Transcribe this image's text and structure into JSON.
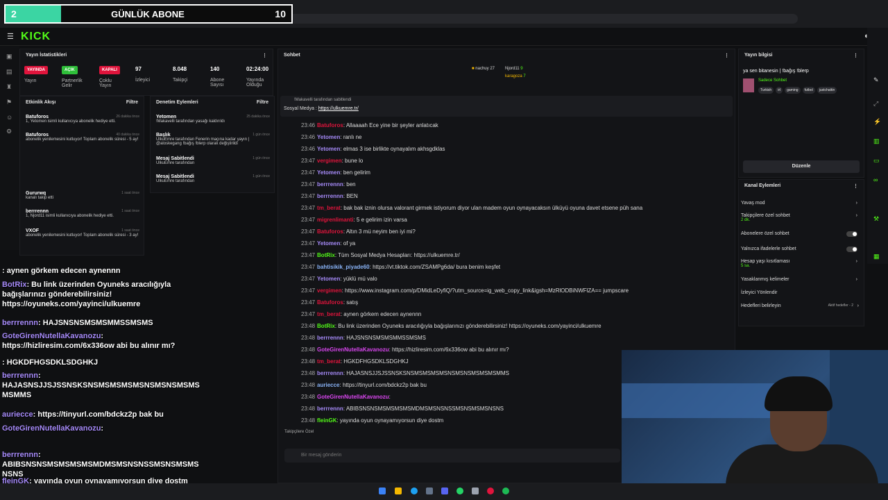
{
  "browser": {
    "url": "dashboard.kick.com/stream"
  },
  "sub_goal": {
    "current": "2",
    "label": "GÜNLÜK ABONE",
    "target": "10"
  },
  "stats": {
    "title": "Yayın İstatistikleri",
    "items": [
      {
        "badge": "YAYINDA",
        "label": "Yayın",
        "color": "#e0143c"
      },
      {
        "badge": "AÇIK",
        "label": "Partnerlik Gelir",
        "color": "#2fbf3a"
      },
      {
        "badge": "KAPALI",
        "label": "Çoklu Yayın",
        "color": "#e0143c"
      },
      {
        "value": "97",
        "label": "İzleyici"
      },
      {
        "value": "8.048",
        "label": "Takipçi"
      },
      {
        "value": "140",
        "label": "Abone Sayısı"
      },
      {
        "value": "02:24:00",
        "label": "Yayında Olduğu"
      }
    ]
  },
  "activity": {
    "title": "Etkinlik Akışı",
    "filter": "Filtre",
    "items": [
      {
        "user": "Batuforos",
        "text": "1, Yetomen isimli kullanıcıya abonelik hediye etti.",
        "time": "26 dakika önce"
      },
      {
        "user": "Batuforos",
        "text": "abonelik yenilemesini kutluyor! Toplam abonelik süresi - 5 ay!",
        "time": "40 dakika önce"
      },
      {
        "user": "Gururwq",
        "text": "kanalı takip etti",
        "time": "1 saat önce"
      },
      {
        "user": "berrrennn",
        "text": "1, Njord11 isimli kullanıcıya abonelik hediye etti.",
        "time": "1 saat önce"
      },
      {
        "user": "VXOF",
        "text": "abonelik yenilemesini kutluyor! Toplam abonelik süresi - 3 ay!",
        "time": "1 saat önce"
      }
    ]
  },
  "modacts": {
    "title": "Denetim Eylemleri",
    "filter": "Filtre",
    "items": [
      {
        "user": "Yetomen",
        "text": "!Makavelli tarafından yasağı kaldırıldı",
        "time": "25 dakika önce"
      },
      {
        "user": "Başlık",
        "text": "UlkuEmre tarafından Fenerin maçına kadar yayın | @aloskegang !bağış !blerp olarak değiştirildi",
        "time": "1 gün önce"
      },
      {
        "user": "Mesaj Sabitlendi",
        "text": "UlkuEmre tarafından",
        "time": "1 gün önce"
      },
      {
        "user": "Mesaj Sabitlendi",
        "text": "UlkuEmre tarafından",
        "time": "1 gün önce"
      }
    ]
  },
  "overlay_chat": [
    {
      "user": "",
      "text": ": aynen görkem edecen aynennn"
    },
    {
      "user": "BotRix",
      "text": ": Bu link üzerinden Oyuneks aracılığıyla bağışlarınızı gönderebilirsiniz! https://oyuneks.com/yayinci/ulkuemre"
    },
    {
      "user": "berrrennn",
      "text": ": HAJSNSNSMSMSMMSSMSMS"
    },
    {
      "user": "GoteGirenNutellaKavanozu",
      "text": ": https://hizliresim.com/6x336ow abi bu alınır mı?"
    },
    {
      "user": "",
      "text": ": HGKDFHGSDKLSDGHKJ"
    },
    {
      "user": "berrrennn",
      "text": ": HAJASNSJJSJSSNSKSNSMSMSMSMSNSMSNSMSMS MSMMS"
    },
    {
      "user": "auriecce",
      "text": ": https://tinyurl.com/bdckz2p bak bu"
    },
    {
      "user": "GoteGirenNutellaKavanozu",
      "text": ":"
    },
    {
      "user": "berrrennn",
      "text": ": ABIBSNSNSMSMSMSMSMDMSMSNSNSSMSNSMSMS NSNS"
    },
    {
      "user": "fleinGK",
      "text": ": yayında oyun oynayamıyorsun diye dostm"
    }
  ],
  "chat": {
    "title": "Sohbet",
    "top_users": [
      {
        "name": "nachuy",
        "count": "27"
      },
      {
        "name": "Njord11",
        "count": "9"
      },
      {
        "name": "karagoza",
        "count": "7"
      }
    ],
    "pinned_by": "!Makavelli tarafından sabitlendi",
    "pinned_label": "Sosyal Medya :",
    "pinned_link": "https://ulkuemre.tr/",
    "messages": [
      {
        "time": "23:46",
        "user": "Batuforos",
        "color": "#e0143c",
        "text": ": Allaaaah Ece yine bir şeyler anlatıcak"
      },
      {
        "time": "23:46",
        "user": "Yetomen",
        "color": "#a78bfa",
        "text": ": ranlı ne"
      },
      {
        "time": "23:46",
        "user": "Yetomen",
        "color": "#a78bfa",
        "text": ": elmas 3 ise birlikte oynayalım akhsgdklas"
      },
      {
        "time": "23:47",
        "user": "vergimen",
        "color": "#e0143c",
        "text": ": bune lo"
      },
      {
        "time": "23:47",
        "user": "Yetomen",
        "color": "#a78bfa",
        "text": ": ben gelirim"
      },
      {
        "time": "23:47",
        "user": "berrrennn",
        "color": "#a78bfa",
        "text": ": ben"
      },
      {
        "time": "23:47",
        "user": "berrrennn",
        "color": "#a78bfa",
        "text": ": BEN"
      },
      {
        "time": "23:47",
        "user": "tm_berat",
        "color": "#e0143c",
        "text": ": bak bak iznin olursa valorant girmek istiyorum diyor ulan madem oyun oynayacaksın ülküyü oyuna davet etsene püh sana"
      },
      {
        "time": "23:47",
        "user": "migrenlimanti",
        "color": "#e0143c",
        "text": ": 5 e gelirim izin varsa"
      },
      {
        "time": "23:47",
        "user": "Batuforos",
        "color": "#e0143c",
        "text": ": Altın 3 mü neyim ben iyi mi?"
      },
      {
        "time": "23:47",
        "user": "Yetomen",
        "color": "#a78bfa",
        "text": ": of ya"
      },
      {
        "time": "23:47",
        "user": "BotRix",
        "color": "#53fc18",
        "text": ": Tüm Sosyal Medya Hesapları: https://ulkuemre.tr/"
      },
      {
        "time": "23:47",
        "user": "bahtisikik_piyade60",
        "color": "#8ab4f8",
        "text": ": https://vt.tiktok.com/ZSAMPg6da/ bura benim keşfet"
      },
      {
        "time": "23:47",
        "user": "Yetomen",
        "color": "#a78bfa",
        "text": ": yüklü mü valo"
      },
      {
        "time": "23:47",
        "user": "vergimen",
        "color": "#e0143c",
        "text": ": https://www.instagram.com/p/DMidLeDyfiQ/?utm_source=ig_web_copy_link&igsh=MzRlODBiNWFlZA== jumpscare"
      },
      {
        "time": "23:47",
        "user": "Batuforos",
        "color": "#e0143c",
        "text": ": satış"
      },
      {
        "time": "23:47",
        "user": "tm_berat",
        "color": "#e0143c",
        "text": ": aynen görkem edecen aynennn"
      },
      {
        "time": "23:48",
        "user": "BotRix",
        "color": "#53fc18",
        "text": ": Bu link üzerinden Oyuneks aracılığıyla bağışlarınızı gönderebilirsiniz! https://oyuneks.com/yayinci/ulkuemre"
      },
      {
        "time": "23:48",
        "user": "berrrennn",
        "color": "#a78bfa",
        "text": ": HAJSNSNSMSMSMMSSMSMS"
      },
      {
        "time": "23:48",
        "user": "GoteGirenNutellaKavanozu",
        "color": "#d946ef",
        "text": ": https://hizliresim.com/6x336ow abi bu alınır mı?"
      },
      {
        "time": "23:48",
        "user": "tm_berat",
        "color": "#e0143c",
        "text": ": HGKDFHGSDKLSDGHKJ"
      },
      {
        "time": "23:48",
        "user": "berrrennn",
        "color": "#a78bfa",
        "text": ": HAJASNSJJSJSSNSKSNSMSMSMSMSNSMSNSMSMSMSMMS"
      },
      {
        "time": "23:48",
        "user": "auriecce",
        "color": "#8ab4f8",
        "text": ": https://tinyurl.com/bdckz2p bak bu"
      },
      {
        "time": "23:48",
        "user": "GoteGirenNutellaKavanozu",
        "color": "#d946ef",
        "text": ":"
      },
      {
        "time": "23:48",
        "user": "berrrennn",
        "color": "#a78bfa",
        "text": ": ABIBSNSNSMSMSMSMSMDMSMSNSNSSMSNSMSMSNSNS"
      },
      {
        "time": "23:48",
        "user": "fleinGK",
        "color": "#53fc18",
        "text": ": yayında oyun oynayamıyorsun diye dostm"
      }
    ],
    "follower_label": "Takipçilere Özel",
    "input_placeholder": "Bir mesaj gönderin"
  },
  "info": {
    "title": "Yayın bilgisi",
    "stream_title": "ya sen bitanesin | !bağış !blerp",
    "category": "Sadece Sohbet",
    "tags": [
      "Turkish",
      "irl",
      "gaming",
      "futbol",
      "justchattin"
    ],
    "edit": "Düzenle"
  },
  "channel_actions": {
    "title": "Kanal Eylemleri",
    "items": [
      {
        "label": "Yavaş mod",
        "sub": ""
      },
      {
        "label": "Takipçilere özel sohbet",
        "sub": "2 dk."
      },
      {
        "label": "Abonelere özel sohbet",
        "sub": ""
      },
      {
        "label": "Yalnızca ifadelerle sohbet",
        "sub": ""
      },
      {
        "label": "Hesap yaşı kısıtlaması",
        "sub": "5 sa."
      },
      {
        "label": "Yasaklanmış kelimeler",
        "sub": ""
      },
      {
        "label": "İzleyici Yönlendir",
        "sub": ""
      },
      {
        "label": "Hedefleri belirleyin",
        "sub": "Aktif hedefler - 2"
      }
    ]
  },
  "colors": {
    "kick_green": "#53fc18",
    "live_red": "#e0143c"
  }
}
